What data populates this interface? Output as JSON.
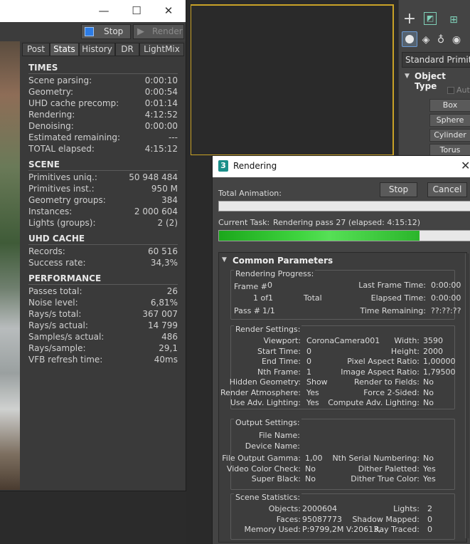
{
  "vfb": {
    "controls": {
      "minimize": "—",
      "maximize": "☐",
      "close": "✕"
    },
    "stop_label": "Stop",
    "render_label": "Render",
    "tabs": [
      "Post",
      "Stats",
      "History",
      "DR",
      "LightMix"
    ],
    "active_tab": "Stats",
    "sections": [
      {
        "title": "TIMES",
        "rows": [
          {
            "k": "Scene parsing:",
            "v": "0:00:10"
          },
          {
            "k": "Geometry:",
            "v": "0:00:54"
          },
          {
            "k": "UHD cache precomp:",
            "v": "0:01:14"
          },
          {
            "k": "Rendering:",
            "v": "4:12:52"
          },
          {
            "k": "Denoising:",
            "v": "0:00:00"
          },
          {
            "k": "Estimated remaining:",
            "v": "---"
          },
          {
            "k": "TOTAL elapsed:",
            "v": "4:15:12"
          }
        ]
      },
      {
        "title": "SCENE",
        "rows": [
          {
            "k": "Primitives uniq.:",
            "v": "50 948 484"
          },
          {
            "k": "Primitives inst.:",
            "v": "950 M"
          },
          {
            "k": "Geometry groups:",
            "v": "384"
          },
          {
            "k": "Instances:",
            "v": "2 000 604"
          },
          {
            "k": "Lights (groups):",
            "v": "2 (2)"
          }
        ]
      },
      {
        "title": "UHD CACHE",
        "rows": [
          {
            "k": "Records:",
            "v": "60 516"
          },
          {
            "k": "Success rate:",
            "v": "34,3%"
          }
        ]
      },
      {
        "title": "PERFORMANCE",
        "rows": [
          {
            "k": "Passes total:",
            "v": "26"
          },
          {
            "k": "Noise level:",
            "v": "6,81%"
          },
          {
            "k": "Rays/s total:",
            "v": "367 007"
          },
          {
            "k": "Rays/s actual:",
            "v": "14 799"
          },
          {
            "k": "Samples/s actual:",
            "v": "486"
          },
          {
            "k": "Rays/sample:",
            "v": "29,1"
          },
          {
            "k": "VFB refresh time:",
            "v": "40ms"
          }
        ]
      }
    ]
  },
  "command_panel": {
    "dropdown": "Standard Primitives",
    "rollout_title": "Object Type",
    "autogrid": "Aut",
    "buttons": [
      "Box",
      "Sphere",
      "Cylinder",
      "Torus"
    ]
  },
  "rendering": {
    "title": "Rendering",
    "app_badge": "3",
    "stop": "Stop",
    "cancel": "Cancel",
    "total_animation": "Total Animation:",
    "current_task_label": "Current Task:",
    "current_task": "Rendering pass 27 (elapsed: 4:15:12)",
    "total_progress": 0,
    "task_progress": 0.8,
    "common_parameters": "Common Parameters",
    "progress": {
      "title": "Rendering Progress:",
      "frame_label": "Frame #",
      "frame": "0",
      "of": "1 of",
      "of_count": "1",
      "total": "Total",
      "pass_label": "Pass #",
      "pass": "1/1",
      "last_frame_label": "Last Frame Time:",
      "last_frame": "0:00:00",
      "elapsed_label": "Elapsed Time:",
      "elapsed": "0:00:00",
      "remaining_label": "Time Remaining:",
      "remaining": "??:??:??"
    },
    "render_settings": {
      "title": "Render Settings:",
      "left": [
        {
          "k": "Viewport:",
          "v": "CoronaCamera001"
        },
        {
          "k": "Start Time:",
          "v": "0"
        },
        {
          "k": "End Time:",
          "v": "0"
        },
        {
          "k": "Nth Frame:",
          "v": "1"
        },
        {
          "k": "Hidden Geometry:",
          "v": "Show"
        },
        {
          "k": "Render Atmosphere:",
          "v": "Yes"
        },
        {
          "k": "Use Adv. Lighting:",
          "v": "Yes"
        }
      ],
      "right": [
        {
          "k": "Width:",
          "v": "3590"
        },
        {
          "k": "Height:",
          "v": "2000"
        },
        {
          "k": "Pixel Aspect Ratio:",
          "v": "1,00000"
        },
        {
          "k": "Image Aspect Ratio:",
          "v": "1,79500"
        },
        {
          "k": "Render to Fields:",
          "v": "No"
        },
        {
          "k": "Force 2-Sided:",
          "v": "No"
        },
        {
          "k": "Compute Adv. Lighting:",
          "v": "No"
        }
      ]
    },
    "output_settings": {
      "title": "Output Settings:",
      "file_name": "File Name:",
      "device_name": "Device Name:",
      "left": [
        {
          "k": "File Output Gamma:",
          "v": "1,00"
        },
        {
          "k": "Video Color Check:",
          "v": "No"
        },
        {
          "k": "Super Black:",
          "v": "No"
        }
      ],
      "right": [
        {
          "k": "Nth Serial Numbering:",
          "v": "No"
        },
        {
          "k": "Dither Paletted:",
          "v": "Yes"
        },
        {
          "k": "Dither True Color:",
          "v": "Yes"
        }
      ]
    },
    "scene_statistics": {
      "title": "Scene Statistics:",
      "left": [
        {
          "k": "Objects:",
          "v": "2000604"
        },
        {
          "k": "Faces:",
          "v": "95087773"
        },
        {
          "k": "Memory Used:",
          "v": "P:9799,2M V:20613,"
        }
      ],
      "right": [
        {
          "k": "Lights:",
          "v": "2"
        },
        {
          "k": "Shadow Mapped:",
          "v": "0"
        },
        {
          "k": "Ray Traced:",
          "v": "0"
        }
      ]
    }
  },
  "colors": {
    "accent": "#c9a227",
    "progress": "#36c236",
    "stop_icon": "#2c7be5"
  }
}
